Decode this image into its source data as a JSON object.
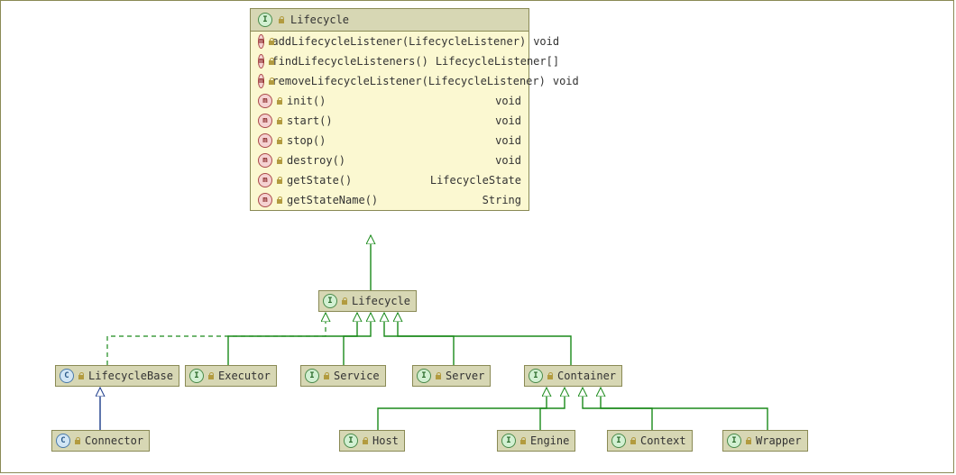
{
  "main_class": {
    "name": "Lifecycle",
    "kind": "I",
    "methods": [
      {
        "sig": "addLifecycleListener(LifecycleListener)",
        "ret": "void"
      },
      {
        "sig": "findLifecycleListeners()",
        "ret": "LifecycleListener[]"
      },
      {
        "sig": "removeLifecycleListener(LifecycleListener)",
        "ret": "void"
      },
      {
        "sig": "init()",
        "ret": "void"
      },
      {
        "sig": "start()",
        "ret": "void"
      },
      {
        "sig": "stop()",
        "ret": "void"
      },
      {
        "sig": "destroy()",
        "ret": "void"
      },
      {
        "sig": "getState()",
        "ret": "LifecycleState"
      },
      {
        "sig": "getStateName()",
        "ret": "String"
      }
    ]
  },
  "nodes": {
    "lifecycle_mid": {
      "name": "Lifecycle",
      "kind": "I"
    },
    "lifecyclebase": {
      "name": "LifecycleBase",
      "kind": "C"
    },
    "executor": {
      "name": "Executor",
      "kind": "I"
    },
    "service": {
      "name": "Service",
      "kind": "I"
    },
    "server": {
      "name": "Server",
      "kind": "I"
    },
    "container": {
      "name": "Container",
      "kind": "I"
    },
    "connector": {
      "name": "Connector",
      "kind": "C"
    },
    "host": {
      "name": "Host",
      "kind": "I"
    },
    "engine": {
      "name": "Engine",
      "kind": "I"
    },
    "context": {
      "name": "Context",
      "kind": "I"
    },
    "wrapper": {
      "name": "Wrapper",
      "kind": "I"
    }
  },
  "edges": [
    {
      "from": "lifecycle_mid",
      "to": "main_class",
      "style": "impl_green"
    },
    {
      "from": "lifecyclebase",
      "to": "lifecycle_mid",
      "style": "dashed_green"
    },
    {
      "from": "executor",
      "to": "lifecycle_mid",
      "style": "impl_green"
    },
    {
      "from": "service",
      "to": "lifecycle_mid",
      "style": "impl_green"
    },
    {
      "from": "server",
      "to": "lifecycle_mid",
      "style": "impl_green"
    },
    {
      "from": "container",
      "to": "lifecycle_mid",
      "style": "impl_green"
    },
    {
      "from": "connector",
      "to": "lifecyclebase",
      "style": "extends_blue"
    },
    {
      "from": "host",
      "to": "container",
      "style": "impl_green"
    },
    {
      "from": "engine",
      "to": "container",
      "style": "impl_green"
    },
    {
      "from": "context",
      "to": "container",
      "style": "impl_green"
    },
    {
      "from": "wrapper",
      "to": "container",
      "style": "impl_green"
    }
  ],
  "chart_data": {
    "type": "uml-class-diagram",
    "interface": {
      "name": "Lifecycle",
      "methods": [
        {
          "name": "addLifecycleListener",
          "params": [
            "LifecycleListener"
          ],
          "returns": "void"
        },
        {
          "name": "findLifecycleListeners",
          "params": [],
          "returns": "LifecycleListener[]"
        },
        {
          "name": "removeLifecycleListener",
          "params": [
            "LifecycleListener"
          ],
          "returns": "void"
        },
        {
          "name": "init",
          "params": [],
          "returns": "void"
        },
        {
          "name": "start",
          "params": [],
          "returns": "void"
        },
        {
          "name": "stop",
          "params": [],
          "returns": "void"
        },
        {
          "name": "destroy",
          "params": [],
          "returns": "void"
        },
        {
          "name": "getState",
          "params": [],
          "returns": "LifecycleState"
        },
        {
          "name": "getStateName",
          "params": [],
          "returns": "String"
        }
      ]
    },
    "nodes": [
      {
        "id": "Lifecycle",
        "kind": "interface"
      },
      {
        "id": "LifecycleBase",
        "kind": "class"
      },
      {
        "id": "Executor",
        "kind": "interface"
      },
      {
        "id": "Service",
        "kind": "interface"
      },
      {
        "id": "Server",
        "kind": "interface"
      },
      {
        "id": "Container",
        "kind": "interface"
      },
      {
        "id": "Connector",
        "kind": "class"
      },
      {
        "id": "Host",
        "kind": "interface"
      },
      {
        "id": "Engine",
        "kind": "interface"
      },
      {
        "id": "Context",
        "kind": "interface"
      },
      {
        "id": "Wrapper",
        "kind": "interface"
      }
    ],
    "relationships": [
      {
        "from": "LifecycleBase",
        "to": "Lifecycle",
        "rel": "implements"
      },
      {
        "from": "Executor",
        "to": "Lifecycle",
        "rel": "extends"
      },
      {
        "from": "Service",
        "to": "Lifecycle",
        "rel": "extends"
      },
      {
        "from": "Server",
        "to": "Lifecycle",
        "rel": "extends"
      },
      {
        "from": "Container",
        "to": "Lifecycle",
        "rel": "extends"
      },
      {
        "from": "Connector",
        "to": "LifecycleBase",
        "rel": "extends"
      },
      {
        "from": "Host",
        "to": "Container",
        "rel": "extends"
      },
      {
        "from": "Engine",
        "to": "Container",
        "rel": "extends"
      },
      {
        "from": "Context",
        "to": "Container",
        "rel": "extends"
      },
      {
        "from": "Wrapper",
        "to": "Container",
        "rel": "extends"
      }
    ]
  }
}
